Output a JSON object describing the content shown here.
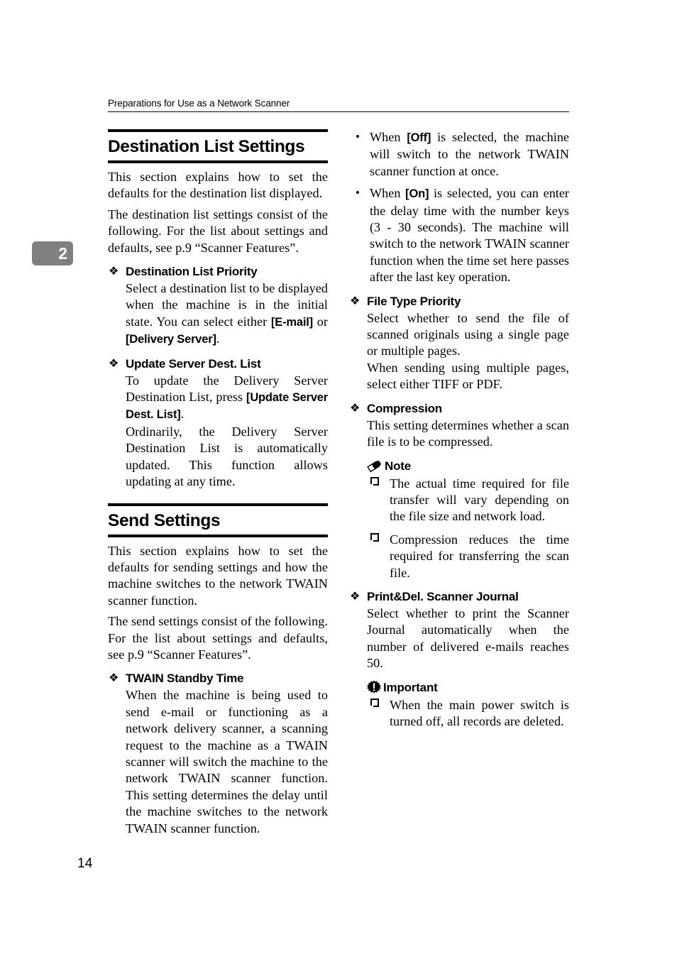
{
  "header": {
    "running_head": "Preparations for Use as a Network Scanner",
    "chapter_number": "2"
  },
  "folio": {
    "page_number": "14"
  },
  "left_column": {
    "section1": {
      "heading": "Destination List Settings",
      "para1": "This section explains how to set the defaults for the destination list displayed.",
      "para2": "The destination list settings consist of the following. For the list about settings and defaults, see p.9 “Scanner Features”.",
      "items": [
        {
          "bullet_icon": "diamond-bullet",
          "title": "Destination List Priority",
          "body_lead": "Select a destination list to be displayed when the machine is in the initial state. You can select either ",
          "ui_key_1": "[E-mail]",
          "body_mid": " or ",
          "ui_key_2": "[Delivery Server]",
          "body_tail": "."
        },
        {
          "bullet_icon": "diamond-bullet",
          "title": "Update Server Dest. List",
          "body_lead": "To update the Delivery Server Destination List, press ",
          "ui_key_1": "[Update Server Dest. List]",
          "body_tail": ".",
          "para2": "Ordinarily, the Delivery Server Destination List is automatically updated. This function allows updating at any time."
        }
      ]
    },
    "section2": {
      "heading": "Send Settings",
      "para1": "This section explains how to set the defaults for sending settings and how the machine switches to the network TWAIN scanner function.",
      "para2": "The send settings consist of the following. For the list about settings and defaults, see p.9 “Scanner Features”.",
      "items": [
        {
          "bullet_icon": "diamond-bullet",
          "title": "TWAIN Standby Time",
          "body": "When the machine is being used to send e-mail or functioning as a network delivery scanner, a scanning request to the machine as a TWAIN scanner will switch the machine to the network TWAIN scanner function. This setting determines the delay until the machine switches to the network TWAIN scanner function."
        }
      ]
    }
  },
  "right_column": {
    "dot_items": [
      {
        "bullet_icon": "round-bullet",
        "lead": "When ",
        "ui_key": "[Off]",
        "tail": " is selected, the machine will switch to the network TWAIN scanner function at once."
      },
      {
        "bullet_icon": "round-bullet",
        "lead": "When ",
        "ui_key": "[On]",
        "tail": " is selected, you can enter the delay time with the number keys (3 - 30 seconds). The machine will switch to the network TWAIN scanner function when the time set here passes after the last key operation."
      }
    ],
    "items": [
      {
        "bullet_icon": "diamond-bullet",
        "title": "File Type Priority",
        "para1": "Select whether to send the file of scanned originals using a single page or multiple pages.",
        "para2": "When sending using multiple pages, select either TIFF or PDF."
      },
      {
        "bullet_icon": "diamond-bullet",
        "title": "Compression",
        "para1": "This setting determines whether a scan file is to be compressed.",
        "note": {
          "icon": "pencil-icon",
          "label": "Note",
          "items": [
            "The actual time required for file transfer will vary depending on the file size and network load.",
            "Compression reduces the time required for transferring the scan file."
          ]
        }
      },
      {
        "bullet_icon": "diamond-bullet",
        "title": "Print&Del. Scanner Journal",
        "para1": "Select whether to print the Scanner Journal automatically when the number of delivered e-mails reaches 50.",
        "important": {
          "icon": "important-starburst-icon",
          "label": "Important",
          "items": [
            "When the main power switch is turned off, all records are deleted."
          ]
        }
      }
    ]
  },
  "glyphs": {
    "diamond": "❖",
    "dot": "•"
  },
  "colors": {
    "text": "#000000",
    "chapter_tab_bg": "#808080",
    "chapter_tab_fg": "#ffffff",
    "page_bg": "#ffffff"
  }
}
